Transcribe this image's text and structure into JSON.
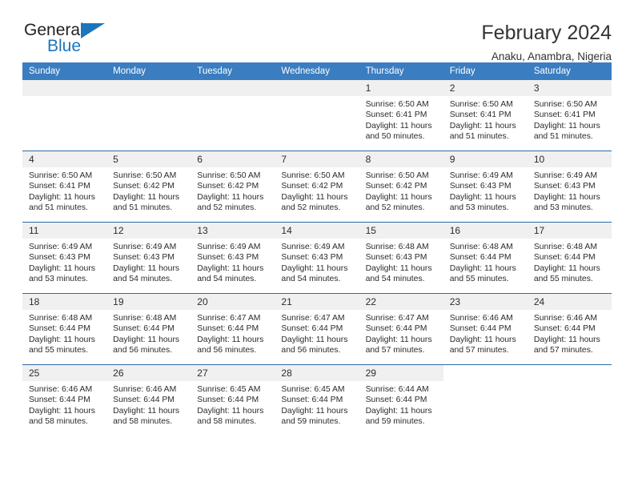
{
  "brand": {
    "name_dark": "General",
    "name_blue": "Blue",
    "triangle_color": "#1b76bc"
  },
  "header": {
    "title": "February 2024",
    "location": "Anaku, Anambra, Nigeria"
  },
  "theme": {
    "header_bg": "#3a7dc0",
    "row_divider": "#2c6aa8",
    "day_num_bg": "#f0f0f0",
    "text": "#2b2b2b"
  },
  "labels": {
    "sunrise_prefix": "Sunrise:",
    "sunset_prefix": "Sunset:",
    "daylight_prefix": "Daylight:"
  },
  "weekdays": [
    "Sunday",
    "Monday",
    "Tuesday",
    "Wednesday",
    "Thursday",
    "Friday",
    "Saturday"
  ],
  "weeks": [
    [
      {
        "day": "",
        "sunrise": "",
        "sunset": "",
        "daylight1": "",
        "daylight2": "",
        "blank": true
      },
      {
        "day": "",
        "sunrise": "",
        "sunset": "",
        "daylight1": "",
        "daylight2": "",
        "blank": true
      },
      {
        "day": "",
        "sunrise": "",
        "sunset": "",
        "daylight1": "",
        "daylight2": "",
        "blank": true
      },
      {
        "day": "",
        "sunrise": "",
        "sunset": "",
        "daylight1": "",
        "daylight2": "",
        "blank": true
      },
      {
        "day": "1",
        "sunrise": "Sunrise: 6:50 AM",
        "sunset": "Sunset: 6:41 PM",
        "daylight1": "Daylight: 11 hours",
        "daylight2": "and 50 minutes."
      },
      {
        "day": "2",
        "sunrise": "Sunrise: 6:50 AM",
        "sunset": "Sunset: 6:41 PM",
        "daylight1": "Daylight: 11 hours",
        "daylight2": "and 51 minutes."
      },
      {
        "day": "3",
        "sunrise": "Sunrise: 6:50 AM",
        "sunset": "Sunset: 6:41 PM",
        "daylight1": "Daylight: 11 hours",
        "daylight2": "and 51 minutes."
      }
    ],
    [
      {
        "day": "4",
        "sunrise": "Sunrise: 6:50 AM",
        "sunset": "Sunset: 6:41 PM",
        "daylight1": "Daylight: 11 hours",
        "daylight2": "and 51 minutes."
      },
      {
        "day": "5",
        "sunrise": "Sunrise: 6:50 AM",
        "sunset": "Sunset: 6:42 PM",
        "daylight1": "Daylight: 11 hours",
        "daylight2": "and 51 minutes."
      },
      {
        "day": "6",
        "sunrise": "Sunrise: 6:50 AM",
        "sunset": "Sunset: 6:42 PM",
        "daylight1": "Daylight: 11 hours",
        "daylight2": "and 52 minutes."
      },
      {
        "day": "7",
        "sunrise": "Sunrise: 6:50 AM",
        "sunset": "Sunset: 6:42 PM",
        "daylight1": "Daylight: 11 hours",
        "daylight2": "and 52 minutes."
      },
      {
        "day": "8",
        "sunrise": "Sunrise: 6:50 AM",
        "sunset": "Sunset: 6:42 PM",
        "daylight1": "Daylight: 11 hours",
        "daylight2": "and 52 minutes."
      },
      {
        "day": "9",
        "sunrise": "Sunrise: 6:49 AM",
        "sunset": "Sunset: 6:43 PM",
        "daylight1": "Daylight: 11 hours",
        "daylight2": "and 53 minutes."
      },
      {
        "day": "10",
        "sunrise": "Sunrise: 6:49 AM",
        "sunset": "Sunset: 6:43 PM",
        "daylight1": "Daylight: 11 hours",
        "daylight2": "and 53 minutes."
      }
    ],
    [
      {
        "day": "11",
        "sunrise": "Sunrise: 6:49 AM",
        "sunset": "Sunset: 6:43 PM",
        "daylight1": "Daylight: 11 hours",
        "daylight2": "and 53 minutes."
      },
      {
        "day": "12",
        "sunrise": "Sunrise: 6:49 AM",
        "sunset": "Sunset: 6:43 PM",
        "daylight1": "Daylight: 11 hours",
        "daylight2": "and 54 minutes."
      },
      {
        "day": "13",
        "sunrise": "Sunrise: 6:49 AM",
        "sunset": "Sunset: 6:43 PM",
        "daylight1": "Daylight: 11 hours",
        "daylight2": "and 54 minutes."
      },
      {
        "day": "14",
        "sunrise": "Sunrise: 6:49 AM",
        "sunset": "Sunset: 6:43 PM",
        "daylight1": "Daylight: 11 hours",
        "daylight2": "and 54 minutes."
      },
      {
        "day": "15",
        "sunrise": "Sunrise: 6:48 AM",
        "sunset": "Sunset: 6:43 PM",
        "daylight1": "Daylight: 11 hours",
        "daylight2": "and 54 minutes."
      },
      {
        "day": "16",
        "sunrise": "Sunrise: 6:48 AM",
        "sunset": "Sunset: 6:44 PM",
        "daylight1": "Daylight: 11 hours",
        "daylight2": "and 55 minutes."
      },
      {
        "day": "17",
        "sunrise": "Sunrise: 6:48 AM",
        "sunset": "Sunset: 6:44 PM",
        "daylight1": "Daylight: 11 hours",
        "daylight2": "and 55 minutes."
      }
    ],
    [
      {
        "day": "18",
        "sunrise": "Sunrise: 6:48 AM",
        "sunset": "Sunset: 6:44 PM",
        "daylight1": "Daylight: 11 hours",
        "daylight2": "and 55 minutes."
      },
      {
        "day": "19",
        "sunrise": "Sunrise: 6:48 AM",
        "sunset": "Sunset: 6:44 PM",
        "daylight1": "Daylight: 11 hours",
        "daylight2": "and 56 minutes."
      },
      {
        "day": "20",
        "sunrise": "Sunrise: 6:47 AM",
        "sunset": "Sunset: 6:44 PM",
        "daylight1": "Daylight: 11 hours",
        "daylight2": "and 56 minutes."
      },
      {
        "day": "21",
        "sunrise": "Sunrise: 6:47 AM",
        "sunset": "Sunset: 6:44 PM",
        "daylight1": "Daylight: 11 hours",
        "daylight2": "and 56 minutes."
      },
      {
        "day": "22",
        "sunrise": "Sunrise: 6:47 AM",
        "sunset": "Sunset: 6:44 PM",
        "daylight1": "Daylight: 11 hours",
        "daylight2": "and 57 minutes."
      },
      {
        "day": "23",
        "sunrise": "Sunrise: 6:46 AM",
        "sunset": "Sunset: 6:44 PM",
        "daylight1": "Daylight: 11 hours",
        "daylight2": "and 57 minutes."
      },
      {
        "day": "24",
        "sunrise": "Sunrise: 6:46 AM",
        "sunset": "Sunset: 6:44 PM",
        "daylight1": "Daylight: 11 hours",
        "daylight2": "and 57 minutes."
      }
    ],
    [
      {
        "day": "25",
        "sunrise": "Sunrise: 6:46 AM",
        "sunset": "Sunset: 6:44 PM",
        "daylight1": "Daylight: 11 hours",
        "daylight2": "and 58 minutes."
      },
      {
        "day": "26",
        "sunrise": "Sunrise: 6:46 AM",
        "sunset": "Sunset: 6:44 PM",
        "daylight1": "Daylight: 11 hours",
        "daylight2": "and 58 minutes."
      },
      {
        "day": "27",
        "sunrise": "Sunrise: 6:45 AM",
        "sunset": "Sunset: 6:44 PM",
        "daylight1": "Daylight: 11 hours",
        "daylight2": "and 58 minutes."
      },
      {
        "day": "28",
        "sunrise": "Sunrise: 6:45 AM",
        "sunset": "Sunset: 6:44 PM",
        "daylight1": "Daylight: 11 hours",
        "daylight2": "and 59 minutes."
      },
      {
        "day": "29",
        "sunrise": "Sunrise: 6:44 AM",
        "sunset": "Sunset: 6:44 PM",
        "daylight1": "Daylight: 11 hours",
        "daylight2": "and 59 minutes."
      },
      {
        "day": "",
        "sunrise": "",
        "sunset": "",
        "daylight1": "",
        "daylight2": "",
        "blank": true
      },
      {
        "day": "",
        "sunrise": "",
        "sunset": "",
        "daylight1": "",
        "daylight2": "",
        "blank": true
      }
    ]
  ]
}
